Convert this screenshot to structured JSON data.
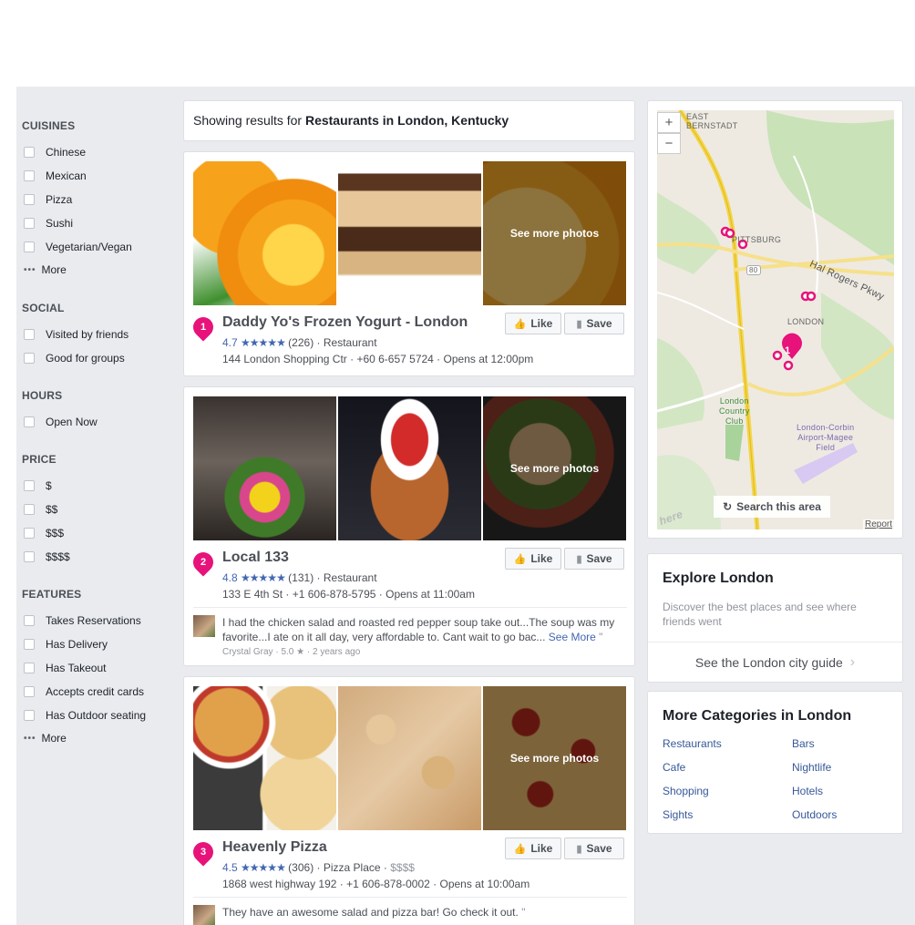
{
  "sidebar": {
    "cuisines": {
      "title": "CUISINES",
      "items": [
        "Chinese",
        "Mexican",
        "Pizza",
        "Sushi",
        "Vegetarian/Vegan"
      ],
      "more": "More"
    },
    "social": {
      "title": "SOCIAL",
      "items": [
        "Visited by friends",
        "Good for groups"
      ]
    },
    "hours": {
      "title": "HOURS",
      "items": [
        "Open Now"
      ]
    },
    "price": {
      "title": "PRICE",
      "items": [
        "$",
        "$$",
        "$$$",
        "$$$$"
      ]
    },
    "features": {
      "title": "FEATURES",
      "items": [
        "Takes Reservations",
        "Has Delivery",
        "Has Takeout",
        "Accepts credit cards",
        "Has Outdoor seating"
      ],
      "more": "More"
    }
  },
  "header": {
    "prefix": "Showing results for ",
    "query": "Restaurants in London, Kentucky"
  },
  "results": [
    {
      "rank": "1",
      "name": "Daddy Yo's Frozen Yogurt - London",
      "rating": "4.7",
      "stars": "★★★★★",
      "reviews": "(226)",
      "category": "Restaurant",
      "price": "",
      "address": "144 London Shopping Ctr · +60 6-657 5724 · Opens at 12:00pm",
      "see_more_photos": "See more photos",
      "like": "Like",
      "save": "Save"
    },
    {
      "rank": "2",
      "name": "Local 133",
      "rating": "4.8",
      "stars": "★★★★★",
      "reviews": "(131)",
      "category": "Restaurant",
      "price": "",
      "address": "133 E 4th St · +1 606-878-5795 · Opens at 11:00am",
      "see_more_photos": "See more photos",
      "like": "Like",
      "save": "Save",
      "review": {
        "text": "I had the chicken salad and roasted red pepper soup take out...The soup was my favorite...I ate on it all day, very affordable to. Cant wait to go bac...",
        "see_more": "See More",
        "author": "Crystal Gray",
        "score": "5.0 ★",
        "when": "2 years ago"
      }
    },
    {
      "rank": "3",
      "name": "Heavenly Pizza",
      "rating": "4.5",
      "stars": "★★★★★",
      "reviews": "(306)",
      "category": "Pizza Place",
      "price": "$$$$",
      "address": "1868 west highway 192 · +1 606-878-0002 · Opens at 10:00am",
      "see_more_photos": "See more photos",
      "like": "Like",
      "save": "Save",
      "review": {
        "text": "They have an awesome salad and pizza bar! Go check it out.",
        "see_more": ""
      }
    }
  ],
  "map": {
    "zoom_in": "+",
    "zoom_out": "−",
    "labels": {
      "east_bernstadt": "EAST\nBERNSTADT",
      "pittsburg": "PITTSBURG",
      "london": "LONDON",
      "hal_rogers": "Hal  Rogers  Pkwy",
      "route80": "80",
      "country_club": "London\nCountry\nClub",
      "airport": "London-Corbin\nAirport-Magee\nField"
    },
    "search_area": "Search this area",
    "report": "Report",
    "watermark": "here",
    "pin_label": "1"
  },
  "explore": {
    "title": "Explore London",
    "desc": "Discover the best places and see where friends went",
    "link": "See the London city guide"
  },
  "categories": {
    "title": "More Categories in London",
    "left": [
      "Restaurants",
      "Cafe",
      "Shopping",
      "Sights"
    ],
    "right": [
      "Bars",
      "Nightlife",
      "Hotels",
      "Outdoors"
    ]
  },
  "colors": {
    "accent": "#4267b2",
    "pin": "#e7127a",
    "bg": "#e9ebee"
  }
}
